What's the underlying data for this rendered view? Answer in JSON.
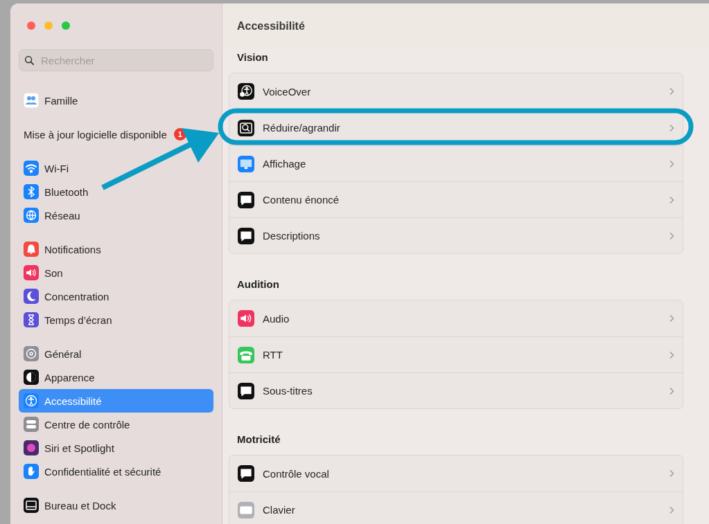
{
  "sidebar": {
    "search": {
      "placeholder": "Rechercher"
    },
    "groups": [
      [
        {
          "label": "Famille",
          "selected": false
        }
      ],
      [
        {
          "label": "Mise à jour logicielle disponible",
          "badge": "1",
          "selected": false
        }
      ],
      [
        {
          "label": "Wi-Fi",
          "selected": false
        },
        {
          "label": "Bluetooth",
          "selected": false
        },
        {
          "label": "Réseau",
          "selected": false
        }
      ],
      [
        {
          "label": "Notifications",
          "selected": false
        },
        {
          "label": "Son",
          "selected": false
        },
        {
          "label": "Concentration",
          "selected": false
        },
        {
          "label": "Temps d’écran",
          "selected": false
        }
      ],
      [
        {
          "label": "Général",
          "selected": false
        },
        {
          "label": "Apparence",
          "selected": false
        },
        {
          "label": "Accessibilité",
          "selected": true
        },
        {
          "label": "Centre de contrôle",
          "selected": false
        },
        {
          "label": "Siri et Spotlight",
          "selected": false
        },
        {
          "label": "Confidentialité et sécurité",
          "selected": false
        }
      ],
      [
        {
          "label": "Bureau et Dock",
          "selected": false
        }
      ]
    ]
  },
  "main": {
    "title": "Accessibilité",
    "sections": [
      {
        "title": "Vision",
        "rows": [
          {
            "label": "VoiceOver"
          },
          {
            "label": "Réduire/agrandir"
          },
          {
            "label": "Affichage"
          },
          {
            "label": "Contenu énoncé"
          },
          {
            "label": "Descriptions"
          }
        ]
      },
      {
        "title": "Audition",
        "rows": [
          {
            "label": "Audio"
          },
          {
            "label": "RTT"
          },
          {
            "label": "Sous-titres"
          }
        ]
      },
      {
        "title": "Motricité",
        "rows": [
          {
            "label": "Contrôle vocal"
          },
          {
            "label": "Clavier"
          }
        ]
      }
    ]
  }
}
